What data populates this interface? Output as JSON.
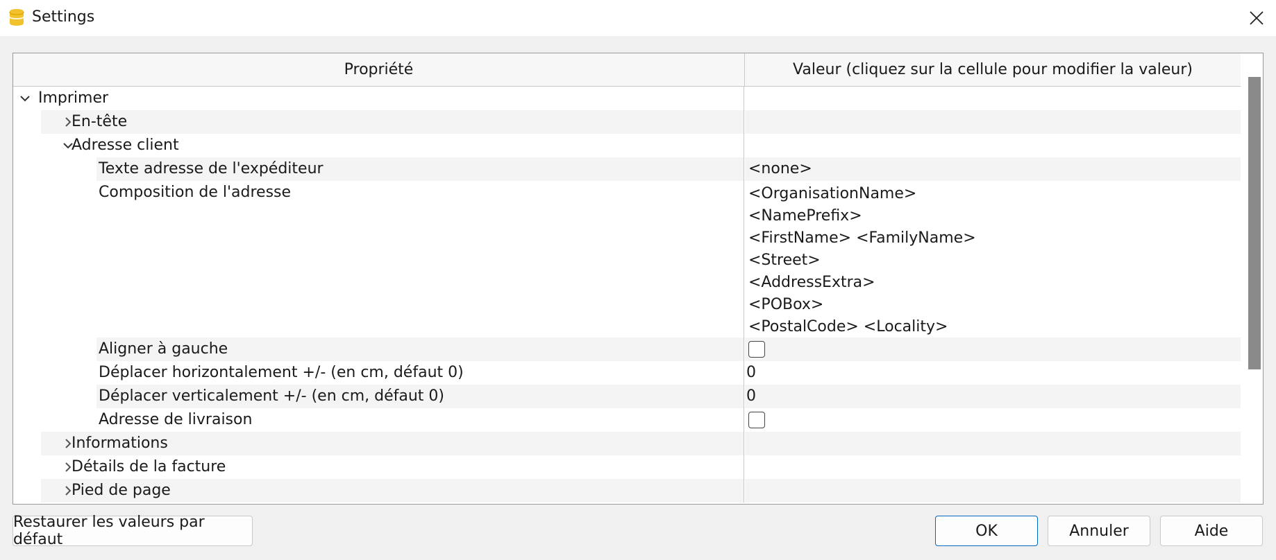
{
  "window": {
    "title": "Settings",
    "app_icon": "database-icon",
    "close_icon": "close-icon"
  },
  "table": {
    "headers": {
      "property": "Propriété",
      "value": "Valeur (cliquez sur la cellule pour modifier la valeur)"
    },
    "rows": {
      "imprimer": {
        "label": "Imprimer",
        "expanded": true
      },
      "entete": {
        "label": "En-tête",
        "expanded": false
      },
      "adresse_client": {
        "label": "Adresse client",
        "expanded": true
      },
      "texte_adresse": {
        "label": "Texte adresse de l'expéditeur",
        "value": "<none>"
      },
      "composition": {
        "label": "Composition de l'adresse",
        "lines": [
          "<OrganisationName>",
          "<NamePrefix>",
          "<FirstName> <FamilyName>",
          "<Street>",
          "<AddressExtra>",
          "<POBox>",
          "<PostalCode> <Locality>"
        ]
      },
      "aligner": {
        "label": "Aligner à gauche",
        "checked": false
      },
      "deplacer_h": {
        "label": "Déplacer horizontalement +/- (en cm, défaut 0)",
        "value": "0"
      },
      "deplacer_v": {
        "label": "Déplacer verticalement +/- (en cm, défaut 0)",
        "value": "0"
      },
      "livraison": {
        "label": "Adresse de livraison",
        "checked": false
      },
      "informations": {
        "label": "Informations",
        "expanded": false
      },
      "details": {
        "label": "Détails de la facture",
        "expanded": false
      },
      "pied": {
        "label": "Pied de page",
        "expanded": false
      }
    }
  },
  "buttons": {
    "restore": "Restaurer les valeurs par défaut",
    "ok": "OK",
    "cancel": "Annuler",
    "help": "Aide"
  },
  "colors": {
    "accent": "#0067c0",
    "app_icon": "#f2c12e",
    "row_shade": "#f4f4f4",
    "scroll_thumb": "#8a8a8a"
  }
}
